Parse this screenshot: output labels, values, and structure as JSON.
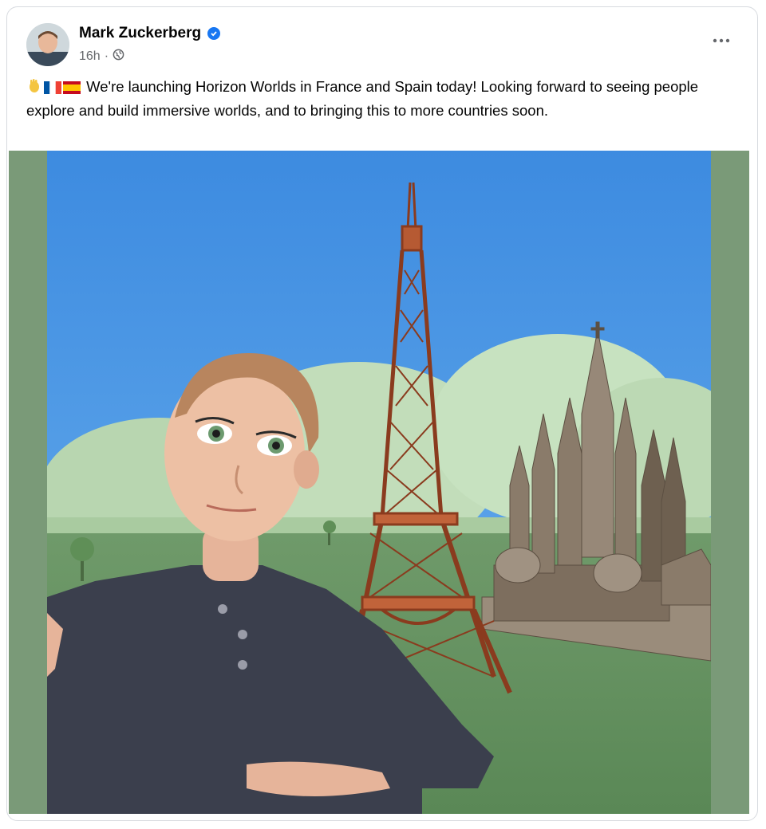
{
  "post": {
    "author": "Mark Zuckerberg",
    "time": "16h",
    "separator": "·",
    "caption": "We're launching Horizon Worlds in France and Spain today! Looking forward to seeing people explore and build immersive worlds, and to bringing this to more countries soon.",
    "emojis": [
      "waving-hand",
      "flag-france",
      "flag-spain"
    ]
  },
  "icons": {
    "verified": "verified-badge-icon",
    "audience": "globe-icon",
    "more": "more-options-icon"
  },
  "colors": {
    "verified_blue": "#1877f2",
    "meta_gray": "#65676b",
    "media_border_green": "#7a9a78",
    "sky_blue": "#3e8fe0"
  }
}
